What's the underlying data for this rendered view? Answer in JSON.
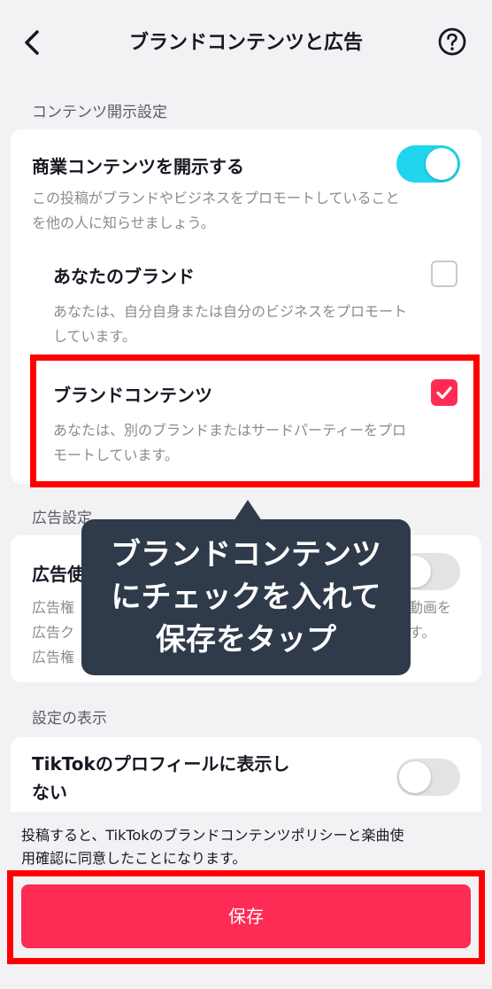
{
  "header": {
    "title": "ブランドコンテンツと広告",
    "back_icon": "chevron-left-icon",
    "help_icon": "question-circle-icon"
  },
  "disclosure_section": {
    "label": "コンテンツ開示設定",
    "main_toggle_title": "商業コンテンツを開示する",
    "main_toggle_state": "on",
    "main_toggle_desc_1": "この投稿がブランドやビジネスをプロモートしていること",
    "main_toggle_desc_2": "を他の人に知らせましょう。",
    "your_brand": {
      "title": "あなたのブランド",
      "checked": false,
      "desc_1": "あなたは、自分自身または自分のビジネスをプロモート",
      "desc_2": "しています。"
    },
    "branded_content": {
      "title": "ブランドコンテンツ",
      "checked": true,
      "desc_1": "あなたは、別のブランドまたはサードパーティーをプロ",
      "desc_2": "モートしています。"
    }
  },
  "ad_section": {
    "label": "広告設定",
    "title_partial": "広告使",
    "desc_left_1": "広告権",
    "desc_left_2": "広告ク",
    "desc_right_1": "動画を",
    "desc_right_2": "す。",
    "desc_left_3": "広告権"
  },
  "tooltip": {
    "line1": "ブランドコンテンツ",
    "line2": "にチェックを入れて",
    "line3": "保存をタップ"
  },
  "display_section": {
    "label": "設定の表示",
    "title_line1": "TikTokのプロフィールに表示し",
    "title_line2": "ない",
    "toggle_state": "off"
  },
  "footer": {
    "note_line1": "投稿すると、TikTokのブランドコンテンツポリシーと楽曲使",
    "note_line2": "用確認に同意したことになります。",
    "save_label": "保存"
  },
  "colors": {
    "accent": "#fe2c55",
    "toggle_on": "#20d5ec",
    "highlight": "#ff0000",
    "tooltip_bg": "#2f3a4a"
  }
}
